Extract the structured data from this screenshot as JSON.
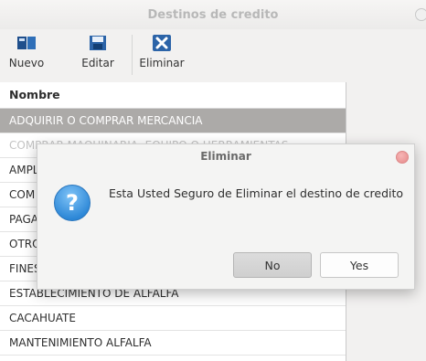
{
  "window": {
    "title": "Destinos de credito"
  },
  "toolbar": {
    "buttons": [
      {
        "label": "Nuevo",
        "icon": "new-icon"
      },
      {
        "label": "Editar",
        "icon": "edit-icon"
      },
      {
        "label": "Eliminar",
        "icon": "delete-icon"
      }
    ]
  },
  "table": {
    "header": "Nombre",
    "rows": [
      "ADQUIRIR O COMPRAR MERCANCIA",
      "COMPRAR MAQUINARIA, EQUIPO O HERRAMIENTAS",
      "AMPL",
      "COM",
      "PAGA",
      "OTRO",
      "FINES",
      "ESTABLECIMIENTO DE ALFALFA",
      "CACAHUATE",
      "MANTENIMIENTO ALFALFA"
    ]
  },
  "dialog": {
    "title": "Eliminar",
    "message": "Esta Usted Seguro de Eliminar el destino de credito",
    "icon": "question-icon",
    "no_label": "No",
    "yes_label": "Yes"
  },
  "colors": {
    "selection": "#acaaa8",
    "info_blue": "#2b86d6"
  }
}
